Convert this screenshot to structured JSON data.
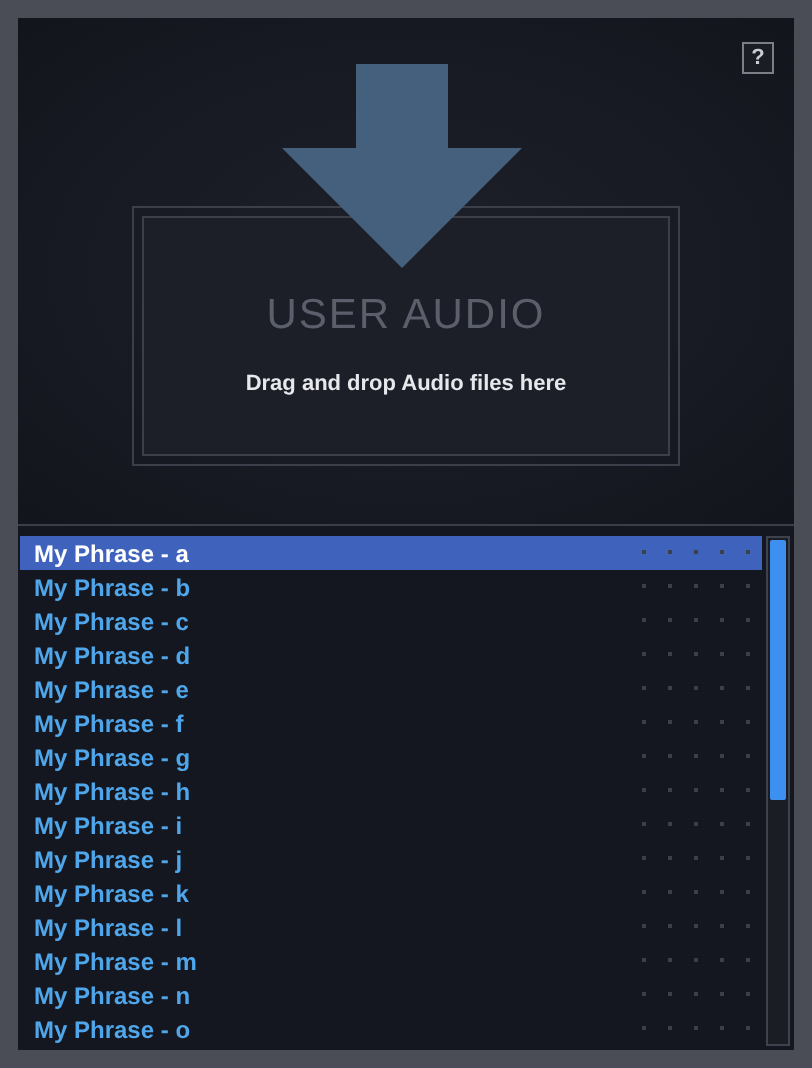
{
  "help_button": "?",
  "drop_zone": {
    "title": "USER AUDIO",
    "hint": "Drag and drop Audio files here"
  },
  "phrases": [
    {
      "label": "My Phrase - a",
      "selected": true
    },
    {
      "label": "My Phrase - b",
      "selected": false
    },
    {
      "label": "My Phrase - c",
      "selected": false
    },
    {
      "label": "My Phrase - d",
      "selected": false
    },
    {
      "label": "My Phrase - e",
      "selected": false
    },
    {
      "label": "My Phrase - f",
      "selected": false
    },
    {
      "label": "My Phrase - g",
      "selected": false
    },
    {
      "label": "My Phrase - h",
      "selected": false
    },
    {
      "label": "My Phrase - i",
      "selected": false
    },
    {
      "label": "My Phrase - j",
      "selected": false
    },
    {
      "label": "My Phrase - k",
      "selected": false
    },
    {
      "label": "My Phrase - l",
      "selected": false
    },
    {
      "label": "My Phrase - m",
      "selected": false
    },
    {
      "label": "My Phrase - n",
      "selected": false
    },
    {
      "label": "My Phrase - o",
      "selected": false
    }
  ]
}
